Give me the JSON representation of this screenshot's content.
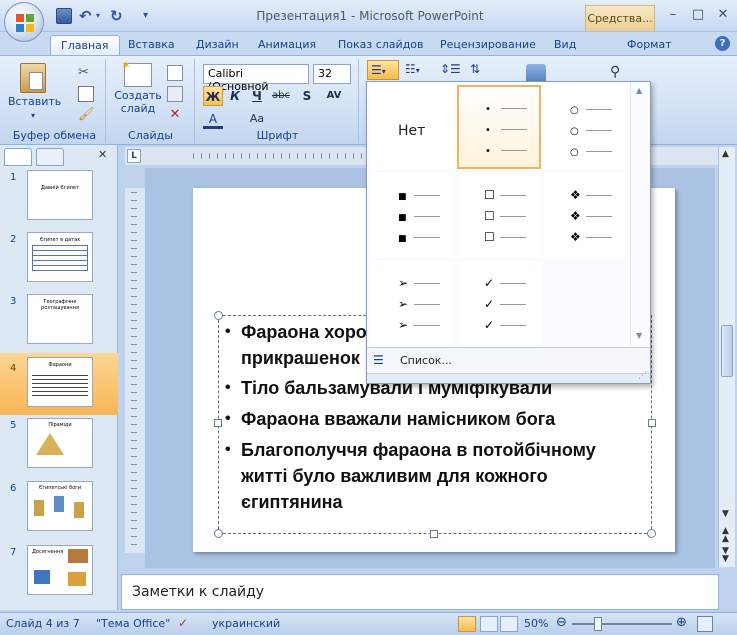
{
  "window": {
    "title": "Презентация1 - Microsoft PowerPoint",
    "context_tab": "Средства...",
    "buttons": {
      "minimize": "–",
      "maximize": "□",
      "close": "✕"
    }
  },
  "tabs": [
    "Главная",
    "Вставка",
    "Дизайн",
    "Анимация",
    "Показ слайдов",
    "Рецензирование",
    "Вид",
    "Формат"
  ],
  "ribbon": {
    "clipboard": {
      "paste_label": "Вставить",
      "group_label": "Буфер обмена"
    },
    "slides": {
      "new_slide_label": "Создать слайд",
      "group_label": "Слайды"
    },
    "font": {
      "font_name": "Calibri (Основной",
      "font_size": "32",
      "group_label": "Шрифт",
      "bold": "Ж",
      "italic": "К",
      "underline": "Ч",
      "strike": "abc",
      "shadow": "S",
      "spacing": "AV"
    }
  },
  "bullets_dropdown": {
    "none_label": "Нет",
    "footer_label": "Список..."
  },
  "slides_panel": {
    "slides": [
      {
        "num": "1",
        "title": "Давній Єгипет"
      },
      {
        "num": "2",
        "title": "Єгипет в датах"
      },
      {
        "num": "3",
        "title": "Географічне розташування"
      },
      {
        "num": "4",
        "title": "Фараони"
      },
      {
        "num": "5",
        "title": "Піраміди"
      },
      {
        "num": "6",
        "title": "Єгипетські боги"
      },
      {
        "num": "7",
        "title": "Досягнення"
      }
    ],
    "selected": 4
  },
  "slide": {
    "bullets": [
      "Фараона хоро",
      "прикрашенок",
      "Тіло бальзамували і муміфікували",
      "Фараона вважали намісником бога",
      "Благополуччя фараона в потойбічному",
      "житті було важливим для кожного",
      "єгиптянина"
    ]
  },
  "notes": {
    "placeholder": "Заметки к слайду"
  },
  "status": {
    "slide_info": "Слайд 4 из 7",
    "theme": "\"Тема Office\"",
    "language": "украинский",
    "zoom": "50%"
  },
  "colors": {
    "accent": "#15428b",
    "ribbon": "#cfdff3",
    "selection": "#f8b556"
  }
}
